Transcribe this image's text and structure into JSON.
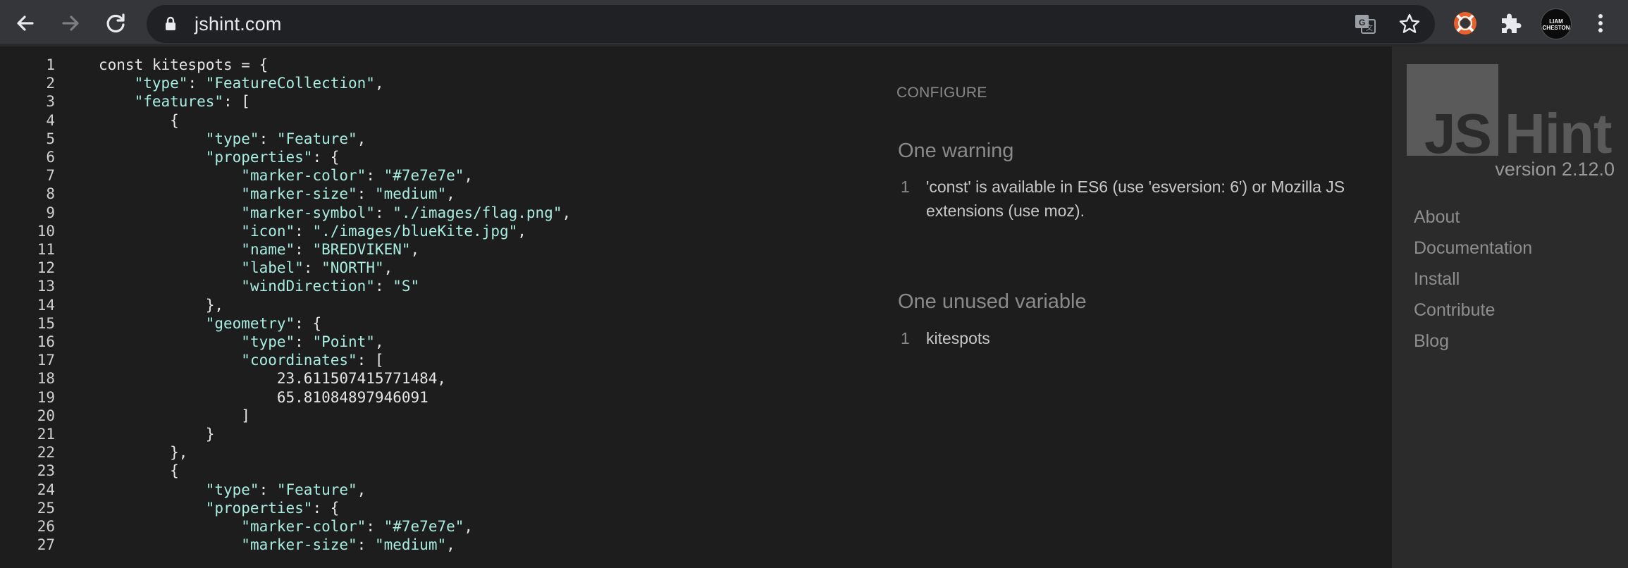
{
  "browser": {
    "url": "jshint.com",
    "avatar_text": "LIAM\nCHESTON",
    "icons": {
      "back": "arrow-left-icon",
      "forward": "arrow-right-icon",
      "reload": "reload-icon",
      "lock": "lock-icon",
      "translate": "translate-icon",
      "bookmark": "star-icon",
      "extension1": "lifebuoy-icon",
      "extensions": "puzzle-icon",
      "menu": "kebab-menu-icon"
    },
    "colors": {
      "toolbar": "#35363a",
      "omnibox": "#202124"
    }
  },
  "editor": {
    "lines": [
      {
        "n": "1",
        "t": "const kitespots = {"
      },
      {
        "n": "2",
        "t": "    \"type\": \"FeatureCollection\","
      },
      {
        "n": "3",
        "t": "    \"features\": ["
      },
      {
        "n": "4",
        "t": "        {"
      },
      {
        "n": "5",
        "t": "            \"type\": \"Feature\","
      },
      {
        "n": "6",
        "t": "            \"properties\": {"
      },
      {
        "n": "7",
        "t": "                \"marker-color\": \"#7e7e7e\","
      },
      {
        "n": "8",
        "t": "                \"marker-size\": \"medium\","
      },
      {
        "n": "9",
        "t": "                \"marker-symbol\": \"./images/flag.png\","
      },
      {
        "n": "10",
        "t": "                \"icon\": \"./images/blueKite.jpg\","
      },
      {
        "n": "11",
        "t": "                \"name\": \"BREDVIKEN\","
      },
      {
        "n": "12",
        "t": "                \"label\": \"NORTH\","
      },
      {
        "n": "13",
        "t": "                \"windDirection\": \"S\""
      },
      {
        "n": "14",
        "t": "            },"
      },
      {
        "n": "15",
        "t": "            \"geometry\": {"
      },
      {
        "n": "16",
        "t": "                \"type\": \"Point\","
      },
      {
        "n": "17",
        "t": "                \"coordinates\": ["
      },
      {
        "n": "18",
        "t": "                    23.611507415771484,"
      },
      {
        "n": "19",
        "t": "                    65.81084897946091"
      },
      {
        "n": "20",
        "t": "                ]"
      },
      {
        "n": "21",
        "t": "            }"
      },
      {
        "n": "22",
        "t": "        },"
      },
      {
        "n": "23",
        "t": "        {"
      },
      {
        "n": "24",
        "t": "            \"type\": \"Feature\","
      },
      {
        "n": "25",
        "t": "            \"properties\": {"
      },
      {
        "n": "26",
        "t": "                \"marker-color\": \"#7e7e7e\","
      },
      {
        "n": "27",
        "t": "                \"marker-size\": \"medium\","
      }
    ],
    "colors": {
      "string": "#a8ede0",
      "text": "#e6e6e6"
    }
  },
  "report": {
    "configure_label": "CONFIGURE",
    "warnings_title": "One warning",
    "warnings": [
      {
        "n": "1",
        "text": "'const' is available in ES6 (use 'esversion: 6') or Mozilla JS extensions (use moz)."
      }
    ],
    "unused_title": "One unused variable",
    "unused": [
      {
        "n": "1",
        "text": "kitespots"
      }
    ]
  },
  "sidebar": {
    "logo_js": "JS",
    "logo_hint": "Hint",
    "version": "version 2.12.0",
    "links": [
      "About",
      "Documentation",
      "Install",
      "Contribute",
      "Blog"
    ]
  }
}
